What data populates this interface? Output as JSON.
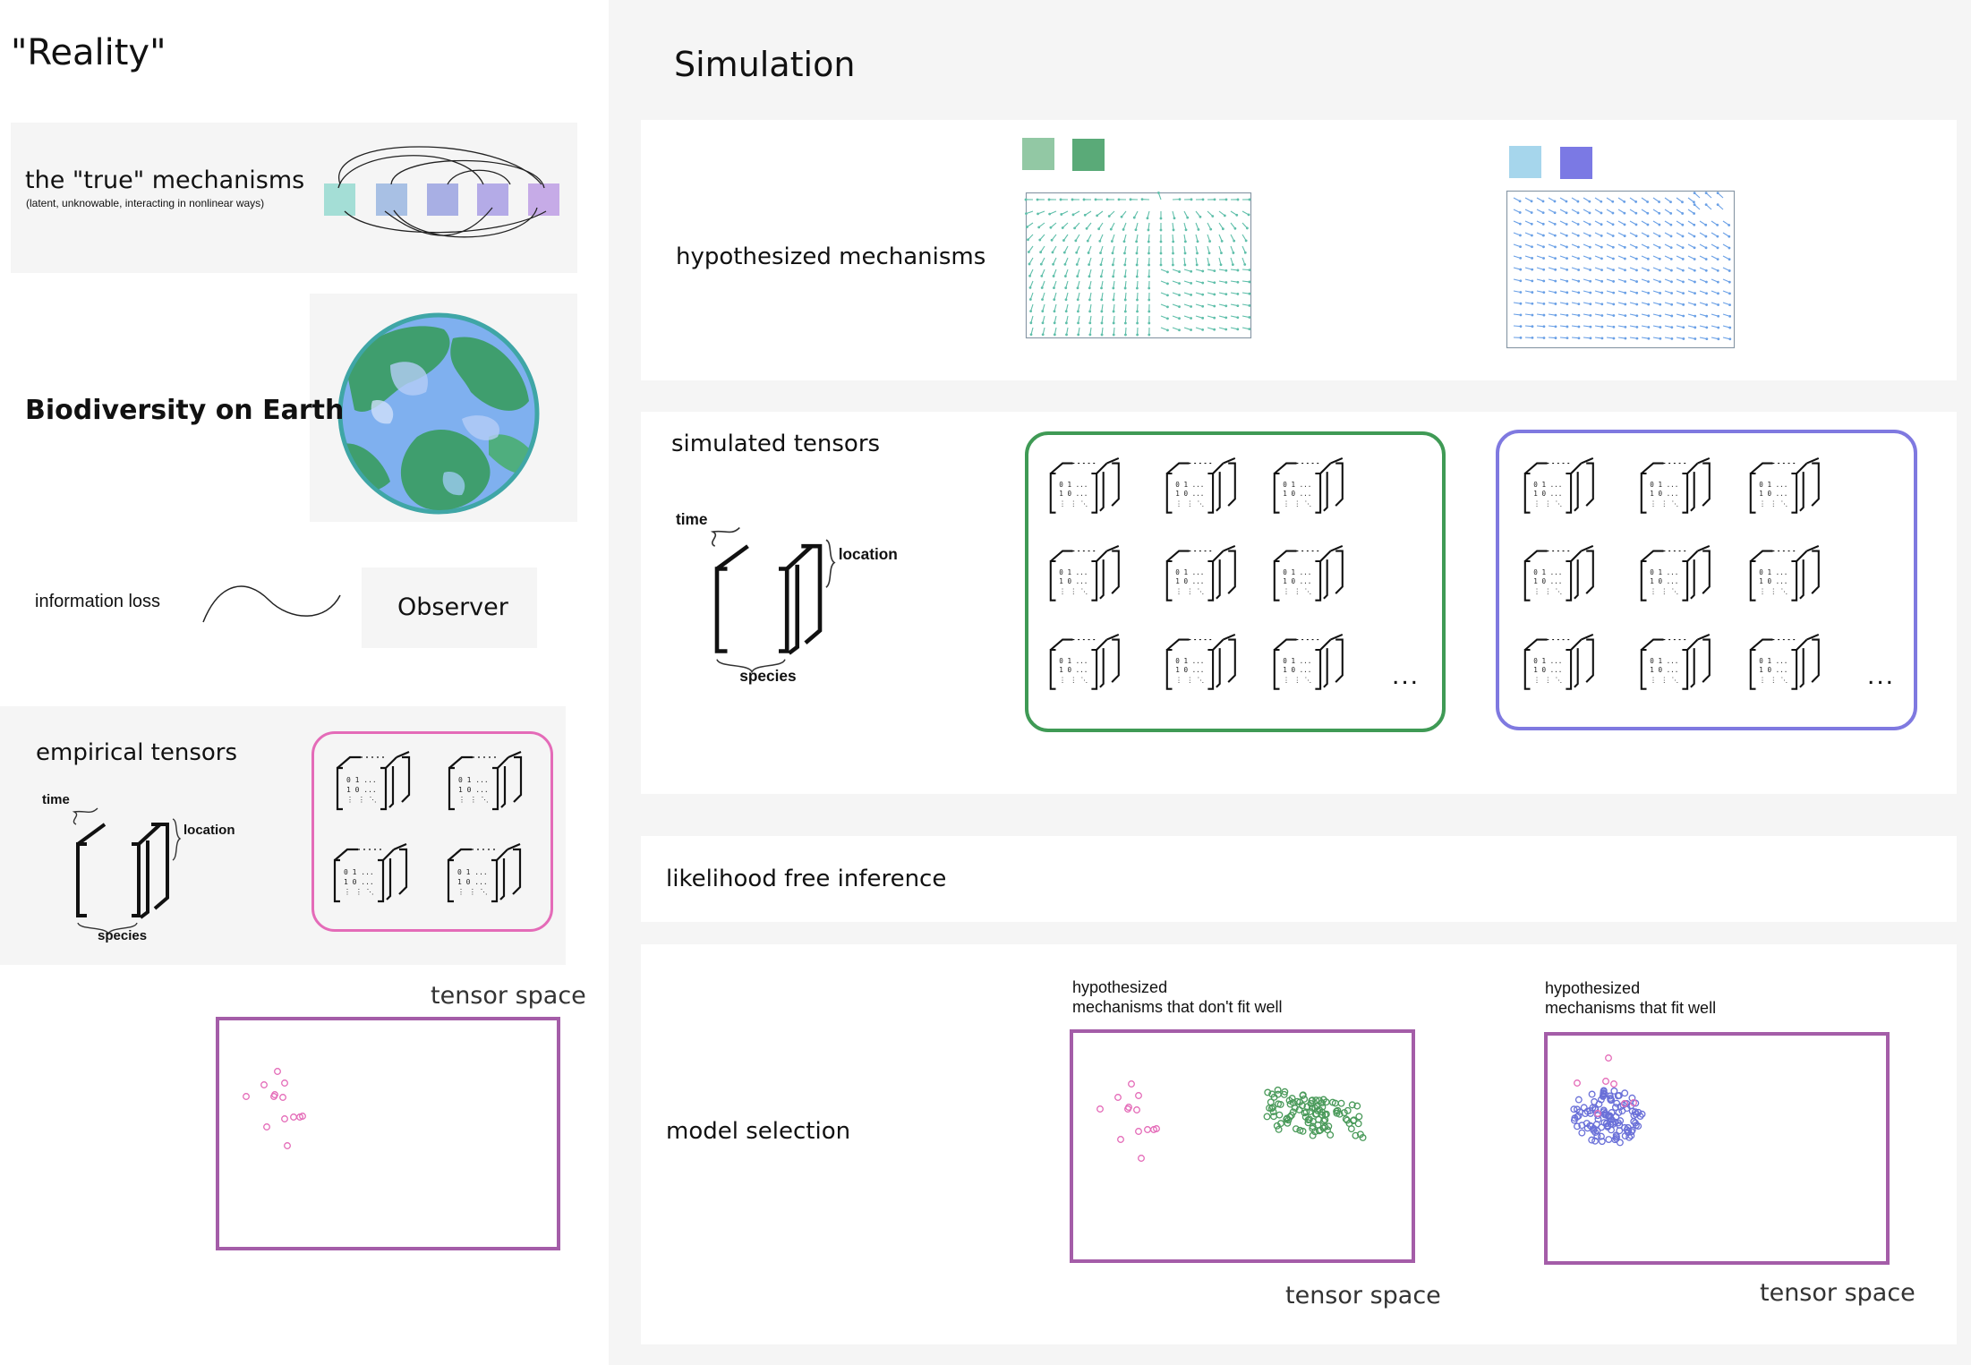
{
  "reality": {
    "title": "\"Reality\"",
    "mechanisms": {
      "label": "the \"true\" mechanisms",
      "sublabel": "(latent, unknowable, interacting in nonlinear ways)",
      "square_colors": [
        "#9fdcd4",
        "#a3bde3",
        "#a3abe3",
        "#b0a6e6",
        "#c3a6e6"
      ]
    },
    "biodiversity": {
      "label": "Biodiversity on Earth"
    },
    "information_loss": {
      "label": "information loss"
    },
    "observer": {
      "label": "Observer"
    },
    "empirical": {
      "title": "empirical tensors",
      "axis_time": "time",
      "axis_location": "location",
      "axis_species": "species",
      "frame_color": "#e46bb8"
    },
    "tensor_space": {
      "label": "tensor space"
    }
  },
  "simulation": {
    "title": "Simulation",
    "hypothesized": {
      "label": "hypothesized mechanisms",
      "set1_colors": [
        "#92c8a4",
        "#5aaa78"
      ],
      "set2_colors": [
        "#a6d6ec",
        "#7b79e4"
      ],
      "field1_color": "#5fbfaa",
      "field2_color": "#6aa0e6"
    },
    "simulated": {
      "title": "simulated tensors",
      "axis_time": "time",
      "axis_location": "location",
      "axis_species": "species",
      "ellipsis": "...",
      "frame1_color": "#3f9a55",
      "frame2_color": "#7f79e0"
    },
    "lfi": {
      "label": "likelihood free inference"
    },
    "model_selection": {
      "label": "model selection",
      "plot1_caption_l1": "hypothesized",
      "plot1_caption_l2": "mechanisms that don't fit well",
      "plot2_caption_l1": "hypothesized",
      "plot2_caption_l2": "mechanisms that fit well",
      "tensor_space_1": "tensor space",
      "tensor_space_2": "tensor space"
    }
  },
  "tensor_glyph": {
    "row1": "0 1 ...",
    "row2": "1 0 ...",
    "row3": "⋮ ⋮ ⋱"
  },
  "colors": {
    "empirical_points": "#e46bb8",
    "green_points": "#4a9a5a",
    "blue_points": "#6a70d8",
    "plot_frame": "#a45da8"
  }
}
